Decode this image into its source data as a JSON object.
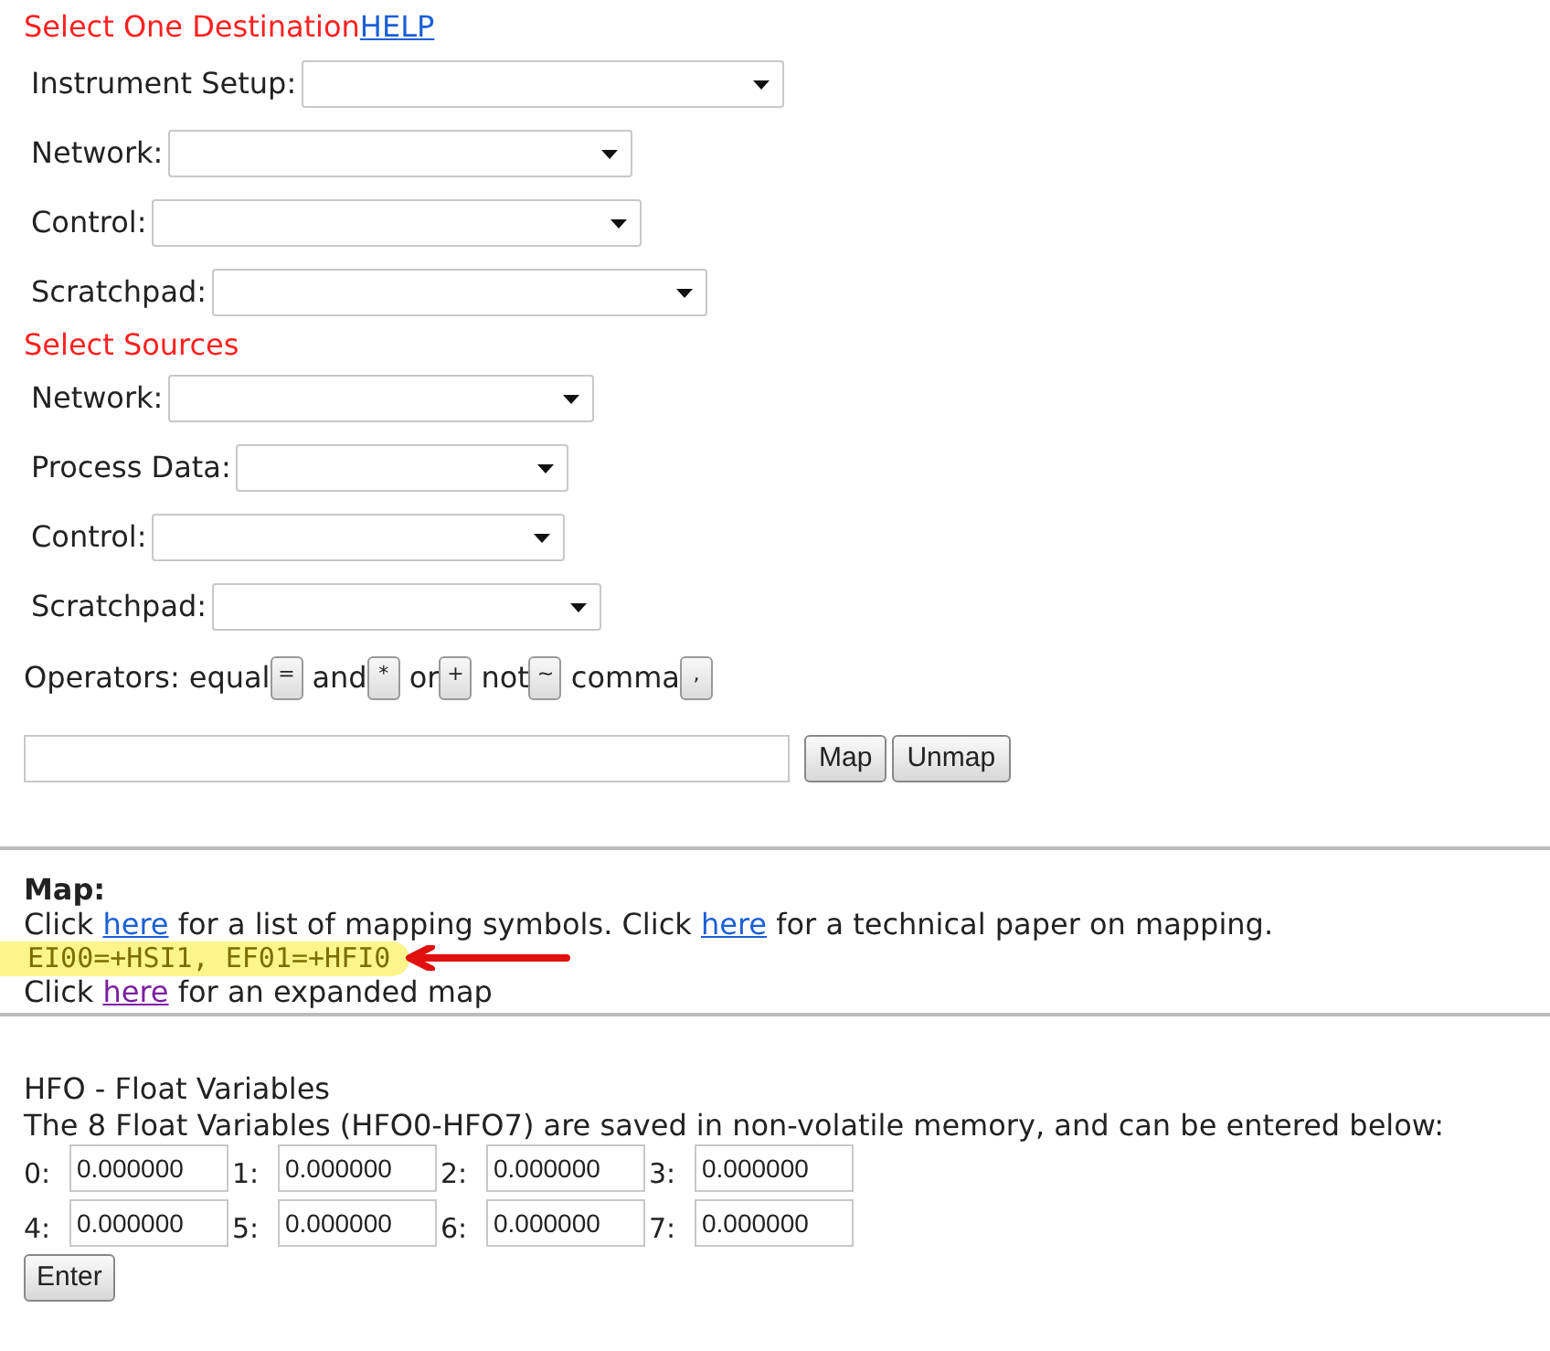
{
  "destination": {
    "heading": "Select One Destination",
    "help_link": "HELP",
    "selects": [
      {
        "label": "Instrument Setup:"
      },
      {
        "label": "Network:"
      },
      {
        "label": "Control:"
      },
      {
        "label": "Scratchpad:"
      }
    ]
  },
  "sources": {
    "heading": "Select Sources",
    "selects": [
      {
        "label": "Network:"
      },
      {
        "label": "Process Data:"
      },
      {
        "label": "Control:"
      },
      {
        "label": "Scratchpad:"
      }
    ]
  },
  "operators": {
    "label": "Operators:",
    "items": [
      {
        "name": "equal",
        "symbol": "="
      },
      {
        "name": "and",
        "symbol": "*"
      },
      {
        "name": "or",
        "symbol": "+"
      },
      {
        "name": "not",
        "symbol": "~"
      },
      {
        "name": "comma",
        "symbol": ","
      }
    ]
  },
  "expression": {
    "buttons": [
      "Map",
      "Unmap"
    ]
  },
  "map": {
    "heading": "Map:",
    "lines": [
      {
        "kind": "text",
        "segments": [
          {
            "kind": "text",
            "text": "Click "
          },
          {
            "kind": "link",
            "text": "here",
            "visited": false
          },
          {
            "kind": "text",
            "text": " for a list of mapping symbols. Click "
          },
          {
            "kind": "link",
            "text": "here",
            "visited": false
          },
          {
            "kind": "text",
            "text": " for a technical paper on mapping."
          }
        ]
      },
      {
        "kind": "code",
        "text": "EI00=+HSI1, EF01=+HFI0",
        "highlighted": true
      },
      {
        "kind": "text",
        "segments": [
          {
            "kind": "text",
            "text": "Click "
          },
          {
            "kind": "link",
            "text": "here",
            "visited": true
          },
          {
            "kind": "text",
            "text": " for an expanded map"
          }
        ]
      }
    ]
  },
  "floats": {
    "title": "HFO - Float Variables",
    "description": "The 8 Float Variables (HFO0-HFO7) are saved in non-volatile memory, and can be entered below:",
    "fields": [
      {
        "label": "0:",
        "value": "0.000000"
      },
      {
        "label": "1:",
        "value": "0.000000"
      },
      {
        "label": "2:",
        "value": "0.000000"
      },
      {
        "label": "3:",
        "value": "0.000000"
      },
      {
        "label": "4:",
        "value": "0.000000"
      },
      {
        "label": "5:",
        "value": "0.000000"
      },
      {
        "label": "6:",
        "value": "0.000000"
      },
      {
        "label": "7:",
        "value": "0.000000"
      }
    ],
    "button": "Enter"
  }
}
